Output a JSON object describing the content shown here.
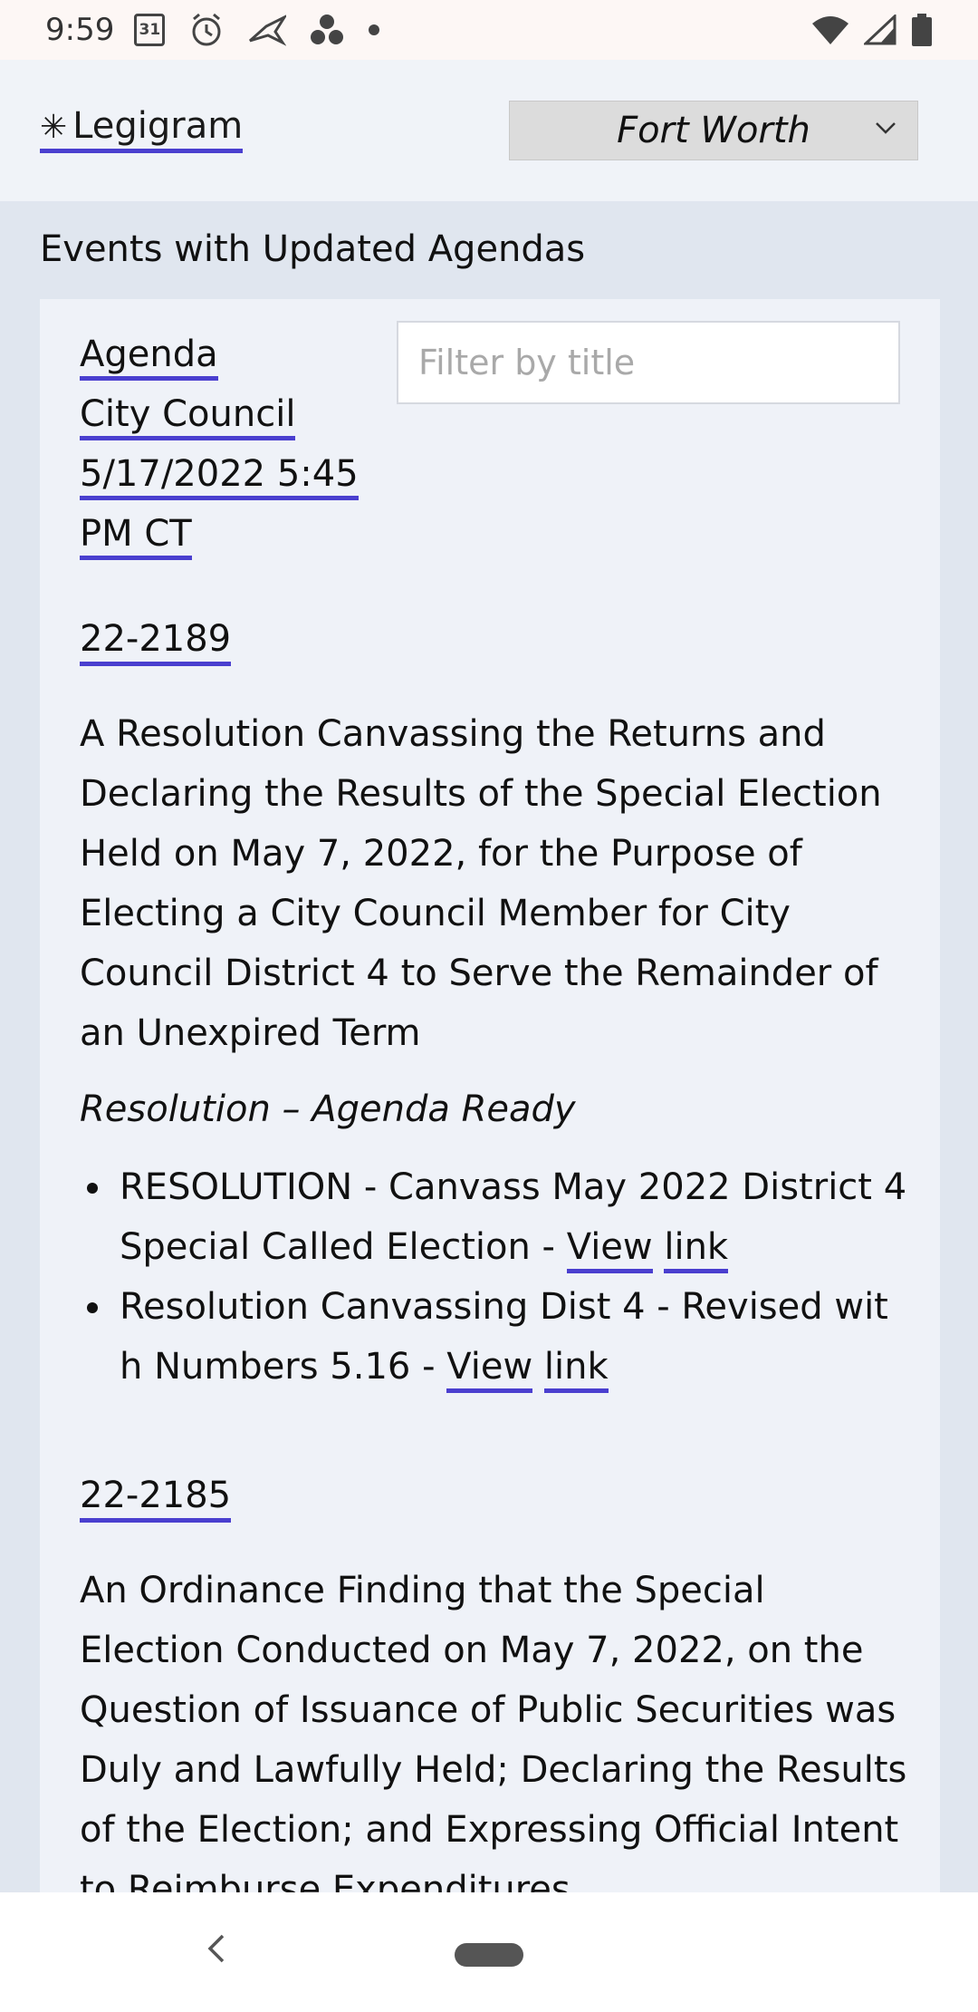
{
  "status_bar": {
    "time": "9:59",
    "calendar_day": "31",
    "icons_left": [
      "calendar-icon",
      "alarm-icon",
      "bird-icon",
      "dots-cluster-icon",
      "dot-icon"
    ],
    "icons_right": [
      "wifi-icon",
      "signal-icon",
      "battery-icon"
    ]
  },
  "header": {
    "brand_star": "✳",
    "brand": "Legigram",
    "city": "Fort Worth"
  },
  "main": {
    "section_title": "Events with Updated Agendas",
    "meta": {
      "agenda": "Agenda",
      "body": "City Council",
      "datetime_1": "5/17/2022 5:45",
      "datetime_2": "PM CT"
    },
    "filter_placeholder": "Filter by title",
    "items": [
      {
        "id": "22-2189",
        "description": "A Resolution Canvassing the Returns and Declaring the Results of the Special Election Held on May 7, 2022, for the Purpose of Electing a City Council Member for City Council District 4 to Serve the Remainder of an Unexpired Term",
        "status": "Resolution – Agenda Ready",
        "attachments": [
          {
            "text": "RESOLUTION - Canvass May 2022 District 4 Special Called Election - ",
            "view": "View",
            "link": "link"
          },
          {
            "text": "Resolution Canvassing Dist 4 - Revised wit h Numbers 5.16 - ",
            "view": "View",
            "link": "link"
          }
        ]
      },
      {
        "id": "22-2185",
        "description": "An Ordinance Finding that the Special Election Conducted on May 7, 2022, on the Question of Issuance of Public Securities was Duly and Lawfully Held; Declaring the Results of the Election; and Expressing Official Intent to Reimburse Expenditures"
      }
    ]
  },
  "nav_bar": {
    "icons": [
      "back-icon",
      "home-pill"
    ]
  }
}
